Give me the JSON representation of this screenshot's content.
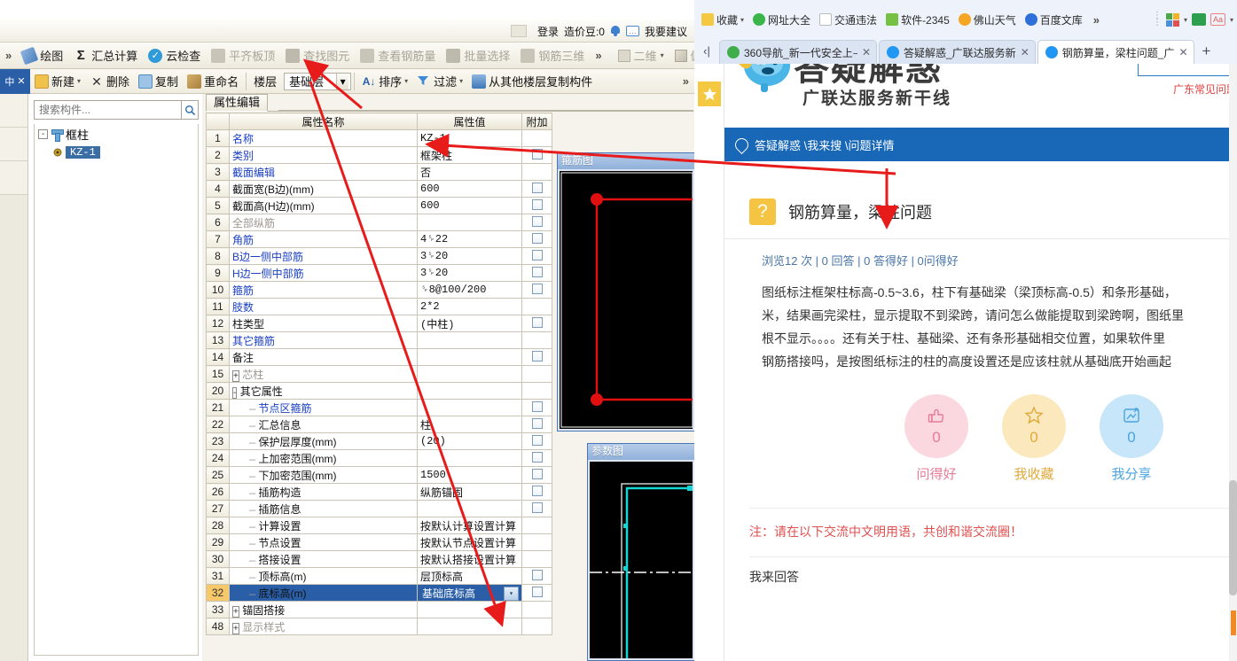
{
  "app": {
    "account": {
      "login": "登录",
      "coins": "造价豆:0",
      "suggest": "我要建议"
    },
    "ribbon": {
      "overflow_left": "»",
      "items": [
        {
          "label": "绘图",
          "icon": "draw-icon",
          "disabled": false
        },
        {
          "label": "汇总计算",
          "icon": "sigma-icon",
          "disabled": false
        },
        {
          "label": "云检查",
          "icon": "cloud-check-icon",
          "disabled": false
        },
        {
          "label": "平齐板顶",
          "icon": "align-slab-icon",
          "disabled": true
        },
        {
          "label": "查找图元",
          "icon": "find-element-icon",
          "disabled": true
        },
        {
          "label": "查看钢筋量",
          "icon": "view-rebar-icon",
          "disabled": true
        },
        {
          "label": "批量选择",
          "icon": "batch-select-icon",
          "disabled": true
        },
        {
          "label": "钢筋三维",
          "icon": "rebar-3d-icon",
          "disabled": true
        }
      ],
      "view_items": [
        {
          "label": "二维",
          "icon": "two-d-icon"
        },
        {
          "label": "俯视",
          "icon": "top-view-icon"
        }
      ]
    },
    "toolbar": {
      "pin": "中",
      "items": [
        {
          "label": "新建",
          "icon": "new-icon",
          "caret": true
        },
        {
          "label": "删除",
          "icon": "delete-icon",
          "caret": false
        },
        {
          "label": "复制",
          "icon": "copy-icon",
          "caret": false
        },
        {
          "label": "重命名",
          "icon": "rename-icon",
          "caret": false
        }
      ],
      "floor_label": "楼层",
      "floor_value": "基础层",
      "sort_label": "排序",
      "filter_label": "过滤",
      "copy_from_floor": "从其他楼层复制构件"
    },
    "tree": {
      "search_placeholder": "搜索构件...",
      "root": {
        "label": "框柱",
        "expander": "-",
        "icon": "column-icon"
      },
      "children": [
        {
          "label": "KZ-1",
          "icon": "member-icon",
          "selected": true
        }
      ]
    },
    "property_panel": {
      "tab": "属性编辑",
      "headers": {
        "index": "",
        "name": "属性名称",
        "value": "属性值",
        "add": "附加"
      },
      "rows": [
        {
          "idx": "1",
          "name": "名称",
          "value": "KZ-1",
          "style": "blue",
          "indent": 0,
          "check": false,
          "tree": "",
          "exp": ""
        },
        {
          "idx": "2",
          "name": "类别",
          "value": "框架柱",
          "style": "blue",
          "indent": 0,
          "check": true,
          "tree": "",
          "exp": ""
        },
        {
          "idx": "3",
          "name": "截面编辑",
          "value": "否",
          "style": "blue",
          "indent": 0,
          "check": false,
          "tree": "",
          "exp": ""
        },
        {
          "idx": "4",
          "name": "截面宽(B边)(mm)",
          "value": "600",
          "style": "black",
          "indent": 0,
          "check": true,
          "tree": "",
          "exp": ""
        },
        {
          "idx": "5",
          "name": "截面高(H边)(mm)",
          "value": "600",
          "style": "black",
          "indent": 0,
          "check": true,
          "tree": "",
          "exp": ""
        },
        {
          "idx": "6",
          "name": "全部纵筋",
          "value": "",
          "style": "grey",
          "indent": 0,
          "check": true,
          "tree": "",
          "exp": ""
        },
        {
          "idx": "7",
          "name": "角筋",
          "value": "4␠22",
          "style": "blue",
          "indent": 0,
          "check": true,
          "tree": "",
          "exp": ""
        },
        {
          "idx": "8",
          "name": "B边一侧中部筋",
          "value": "3␠20",
          "style": "blue",
          "indent": 0,
          "check": true,
          "tree": "",
          "exp": ""
        },
        {
          "idx": "9",
          "name": "H边一侧中部筋",
          "value": "3␠20",
          "style": "blue",
          "indent": 0,
          "check": true,
          "tree": "",
          "exp": ""
        },
        {
          "idx": "10",
          "name": "箍筋",
          "value": "␠8@100/200",
          "style": "blue",
          "indent": 0,
          "check": true,
          "tree": "",
          "exp": ""
        },
        {
          "idx": "11",
          "name": "肢数",
          "value": "2*2",
          "style": "blue",
          "indent": 0,
          "check": false,
          "tree": "",
          "exp": ""
        },
        {
          "idx": "12",
          "name": "柱类型",
          "value": "(中柱)",
          "style": "black",
          "indent": 0,
          "check": true,
          "tree": "",
          "exp": ""
        },
        {
          "idx": "13",
          "name": "其它箍筋",
          "value": "",
          "style": "blue",
          "indent": 0,
          "check": false,
          "tree": "",
          "exp": ""
        },
        {
          "idx": "14",
          "name": "备注",
          "value": "",
          "style": "black",
          "indent": 0,
          "check": true,
          "tree": "",
          "exp": ""
        },
        {
          "idx": "15",
          "name": "芯柱",
          "value": "",
          "style": "grey",
          "indent": 0,
          "check": false,
          "tree": "",
          "exp": "+"
        },
        {
          "idx": "20",
          "name": "其它属性",
          "value": "",
          "style": "black",
          "indent": 0,
          "check": false,
          "tree": "",
          "exp": "-"
        },
        {
          "idx": "21",
          "name": "节点区箍筋",
          "value": "",
          "style": "blue",
          "indent": 1,
          "check": true,
          "tree": "—",
          "exp": ""
        },
        {
          "idx": "22",
          "name": "汇总信息",
          "value": "柱",
          "style": "black",
          "indent": 1,
          "check": true,
          "tree": "—",
          "exp": ""
        },
        {
          "idx": "23",
          "name": "保护层厚度(mm)",
          "value": "(20)",
          "style": "black",
          "indent": 1,
          "check": true,
          "tree": "—",
          "exp": ""
        },
        {
          "idx": "24",
          "name": "上加密范围(mm)",
          "value": "",
          "style": "black",
          "indent": 1,
          "check": true,
          "tree": "—",
          "exp": ""
        },
        {
          "idx": "25",
          "name": "下加密范围(mm)",
          "value": "1500",
          "style": "black",
          "indent": 1,
          "check": true,
          "tree": "—",
          "exp": ""
        },
        {
          "idx": "26",
          "name": "插筋构造",
          "value": "纵筋锚固",
          "style": "black",
          "indent": 1,
          "check": true,
          "tree": "—",
          "exp": ""
        },
        {
          "idx": "27",
          "name": "插筋信息",
          "value": "",
          "style": "black",
          "indent": 1,
          "check": true,
          "tree": "—",
          "exp": ""
        },
        {
          "idx": "28",
          "name": "计算设置",
          "value": "按默认计算设置计算",
          "style": "black",
          "indent": 1,
          "check": false,
          "tree": "—",
          "exp": ""
        },
        {
          "idx": "29",
          "name": "节点设置",
          "value": "按默认节点设置计算",
          "style": "black",
          "indent": 1,
          "check": false,
          "tree": "—",
          "exp": ""
        },
        {
          "idx": "30",
          "name": "搭接设置",
          "value": "按默认搭接设置计算",
          "style": "black",
          "indent": 1,
          "check": false,
          "tree": "—",
          "exp": ""
        },
        {
          "idx": "31",
          "name": "顶标高(m)",
          "value": "层顶标高",
          "style": "black",
          "indent": 1,
          "check": true,
          "tree": "—",
          "exp": ""
        },
        {
          "idx": "32",
          "name": "底标高(m)",
          "value": "基础底标高",
          "style": "black",
          "indent": 1,
          "check": true,
          "tree": "—",
          "exp": "",
          "selected": true,
          "dropdown": true
        },
        {
          "idx": "33",
          "name": "锚固搭接",
          "value": "",
          "style": "black",
          "indent": 0,
          "check": false,
          "tree": "",
          "exp": "+"
        },
        {
          "idx": "48",
          "name": "显示样式",
          "value": "",
          "style": "grey",
          "indent": 0,
          "check": false,
          "tree": "",
          "exp": "+"
        }
      ]
    },
    "cad_panels": [
      {
        "title": "箍筋图",
        "name": "stirrup-diagram"
      },
      {
        "title": "参数图",
        "name": "parameter-diagram"
      }
    ]
  },
  "browser": {
    "bookmarks": [
      {
        "label": "收藏",
        "icon": "star-icon",
        "caret": true
      },
      {
        "label": "网址大全",
        "icon": "green-circle-icon",
        "caret": false
      },
      {
        "label": "交通违法",
        "icon": "page-icon",
        "caret": false
      },
      {
        "label": "软件-2345",
        "icon": "house-icon",
        "caret": false
      },
      {
        "label": "佛山天气",
        "icon": "weather-icon",
        "caret": false
      },
      {
        "label": "百度文库",
        "icon": "baidu-icon",
        "caret": false
      }
    ],
    "bookmarks_overflow": "»",
    "toolbar_right": [
      {
        "icon": "apps-icon",
        "caret": true
      },
      {
        "icon": "book-icon",
        "caret": false
      },
      {
        "icon": "font-size-icon",
        "caret": true
      }
    ],
    "tabs": [
      {
        "label": "360导航_新一代安全上⸺",
        "favicon": "360-icon",
        "active": false
      },
      {
        "label": "答疑解惑_广联达服务新",
        "favicon": "ie-icon",
        "active": false
      },
      {
        "label": "钢筋算量，梁柱问题_广",
        "favicon": "ie-icon",
        "active": true
      }
    ],
    "new_tab": "+",
    "tab_back": "‹|"
  },
  "page": {
    "site_title": "答疑解惑",
    "site_sub": "广联达服务新干线",
    "head_note": "广东常见问题",
    "breadcrumb": "答疑解惑 \\我来搜 \\问题详情",
    "question": {
      "badge": "?",
      "title": "钢筋算量，梁柱问题",
      "stats": "浏览12 次 | 0 回答 | 0 答得好 | 0问得好",
      "body_lines": [
        "图纸标注框架柱标高-0.5~3.6，柱下有基础梁（梁顶标高-0.5）和条形基础，",
        "米，结果画完梁柱，显示提取不到梁跨，请问怎么做能提取到梁跨啊，图纸里",
        "根不显示。。。。还有关于柱、基础梁、还有条形基础相交位置，如果软件里",
        "钢筋搭接吗，是按图纸标注的柱的高度设置还是应该柱就从基础底开始画起"
      ]
    },
    "actions": [
      {
        "count": "0",
        "caption": "问得好",
        "icon": "thumbs-up-icon",
        "key": "a-good"
      },
      {
        "count": "0",
        "caption": "我收藏",
        "icon": "star-outline-icon",
        "key": "a-fav"
      },
      {
        "count": "0",
        "caption": "我分享",
        "icon": "share-icon",
        "key": "a-shr"
      }
    ],
    "notice": "注：请在以下交流中文明用语，共创和谐交流圈！",
    "answer_label": "我来回答"
  }
}
